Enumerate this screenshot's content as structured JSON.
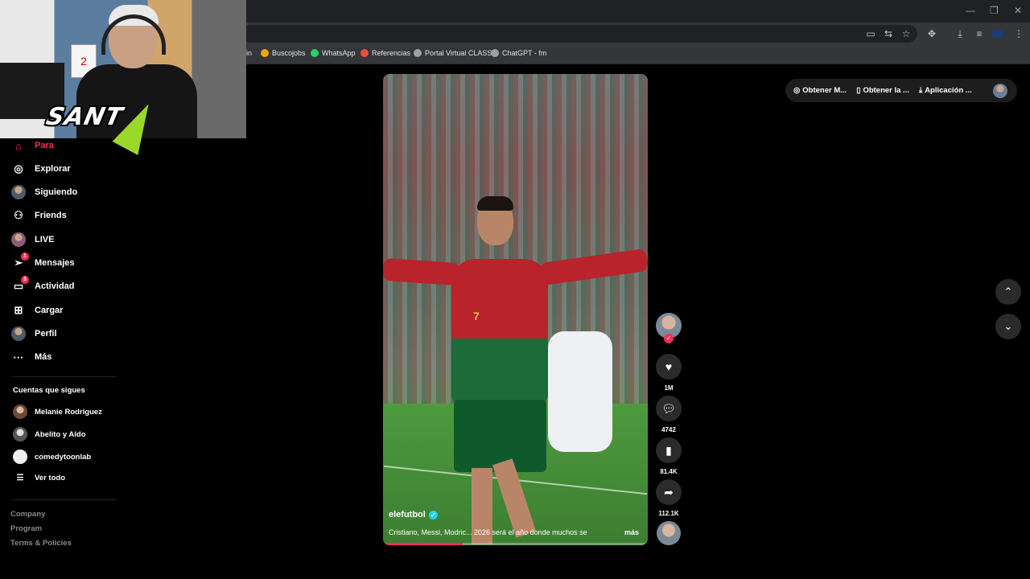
{
  "browser": {
    "bookmarks": [
      {
        "label": "in",
        "color": "#1a73e8"
      },
      {
        "label": "Buscojobs",
        "color": "#f4a300"
      },
      {
        "label": "WhatsApp",
        "color": "#25d366"
      },
      {
        "label": "Referencias",
        "color": "#e8503a"
      },
      {
        "label": "Portal Virtual CLASS",
        "color": "#9aa0a6"
      },
      {
        "label": "ChatGPT - fm",
        "color": "#9aa0a6"
      }
    ]
  },
  "overlay": {
    "logo_text": "SANT",
    "card_number": "2"
  },
  "sidebar": {
    "items": [
      {
        "label": "Para",
        "icon": "home-icon"
      },
      {
        "label": "Explorar",
        "icon": "compass-icon"
      },
      {
        "label": "Siguiendo",
        "icon": "following-avatar-icon"
      },
      {
        "label": "Friends",
        "icon": "friends-icon"
      },
      {
        "label": "LIVE",
        "icon": "live-avatar-icon"
      },
      {
        "label": "Mensajes",
        "icon": "messages-icon",
        "badge": "1"
      },
      {
        "label": "Actividad",
        "icon": "activity-icon",
        "badge": "3"
      },
      {
        "label": "Cargar",
        "icon": "upload-icon"
      },
      {
        "label": "Perfil",
        "icon": "profile-avatar-icon"
      },
      {
        "label": "Más",
        "icon": "more-icon"
      }
    ],
    "following_title": "Cuentas que sigues",
    "following": [
      {
        "name": "Melanie Rodriguez"
      },
      {
        "name": "Abelito y Aldo"
      },
      {
        "name": "comedytoonlab"
      }
    ],
    "see_all": "Ver todo",
    "footer": [
      "Company",
      "Program",
      "Terms & Policies"
    ]
  },
  "topbar": {
    "items": [
      {
        "label": "Obtener M...",
        "icon": "coin-icon"
      },
      {
        "label": "Obtener la ...",
        "icon": "phone-icon"
      },
      {
        "label": "Aplicación ...",
        "icon": "download-icon"
      }
    ]
  },
  "video": {
    "author": "elefutbol",
    "caption": "Cristiano, Messi, Modric... 2026 será el año donde muchos se",
    "more": "más",
    "progress": 0.3,
    "jersey_number": "7"
  },
  "actions": {
    "likes": "1M",
    "comments": "4742",
    "saves": "81.4K",
    "shares": "112.1K"
  },
  "colors": {
    "accent": "#fe2c55",
    "verified": "#20d5ec"
  }
}
